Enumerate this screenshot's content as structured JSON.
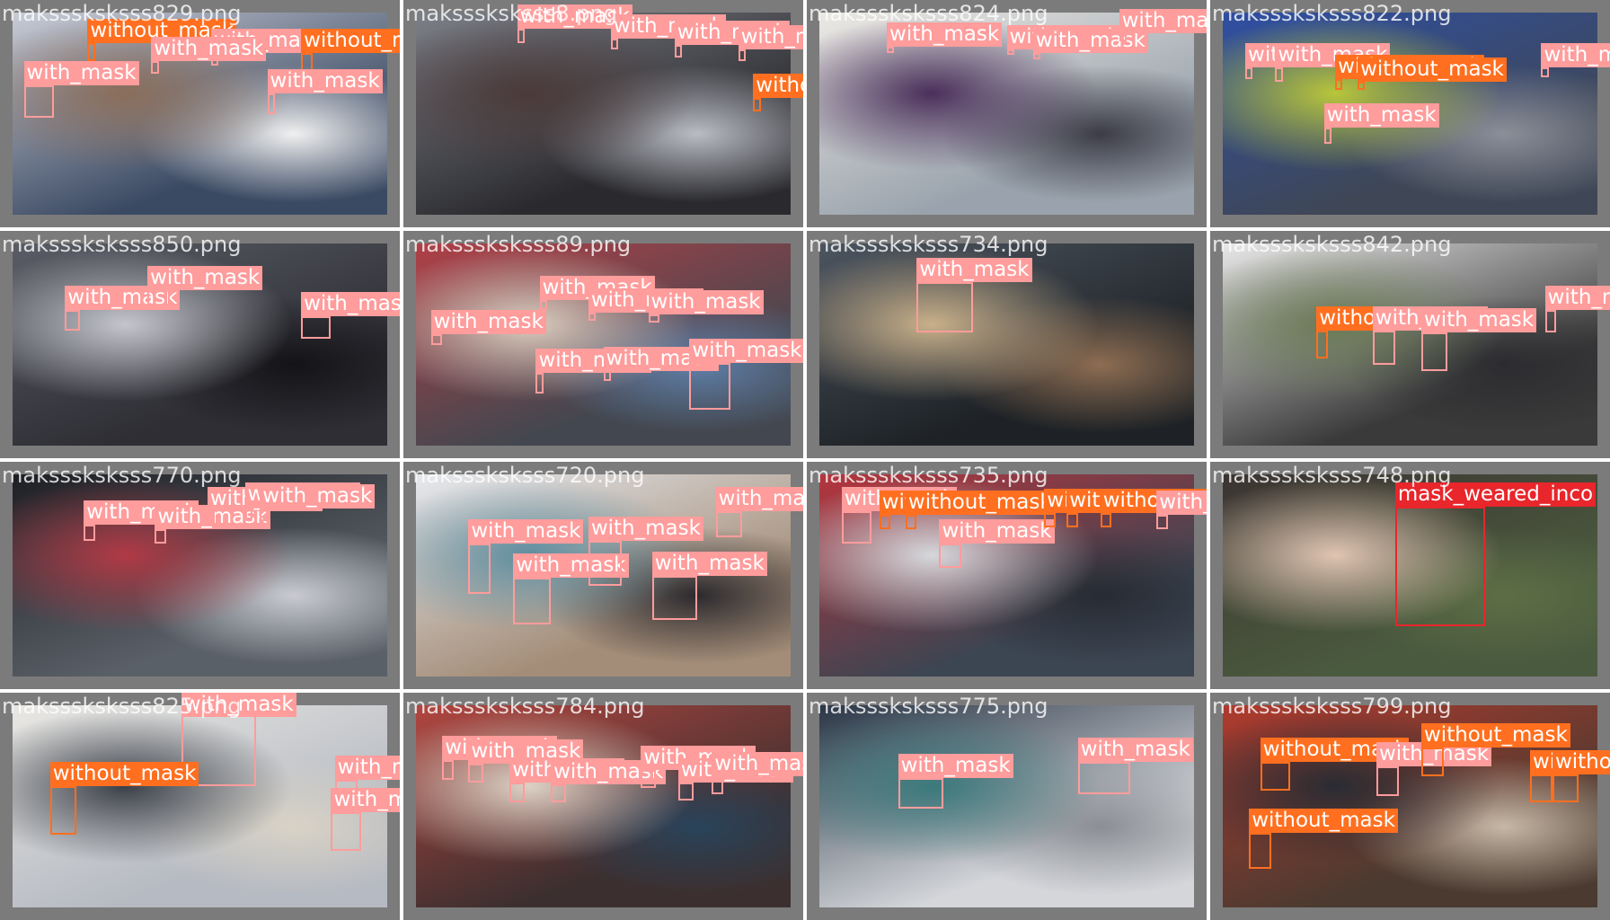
{
  "classes": {
    "with_mask": {
      "label": "with_mask",
      "color": "#ff9c9c"
    },
    "without_mask": {
      "label": "without_mask",
      "color": "#ff6f1f"
    },
    "mask_weared_incorrect": {
      "label": "mask_weared_inco",
      "color": "#e8262b"
    }
  },
  "tiles": [
    {
      "file": "maksssksksss829.png",
      "palette": [
        "#3b4a63",
        "#c9ccd6",
        "#8a6d5a",
        "#f0f0f0"
      ],
      "dets": [
        {
          "c": "with_mask",
          "b": [
            0.03,
            0.36,
            0.11,
            0.52
          ]
        },
        {
          "c": "without_mask",
          "b": [
            0.2,
            0.15,
            0.22,
            0.24
          ]
        },
        {
          "c": "with_mask",
          "b": [
            0.53,
            0.2,
            0.55,
            0.26
          ]
        },
        {
          "c": "without_mask",
          "b": [
            0.77,
            0.2,
            0.8,
            0.33
          ]
        },
        {
          "c": "with_mask",
          "b": [
            0.68,
            0.4,
            0.7,
            0.5
          ]
        },
        {
          "c": "with_mask",
          "b": [
            0.37,
            0.24,
            0.39,
            0.3
          ]
        }
      ]
    },
    {
      "file": "maksssksksss8.png",
      "palette": [
        "#2a2a2e",
        "#7d8088",
        "#4b3a3a",
        "#b9bcc4"
      ],
      "dets": [
        {
          "c": "with_mask",
          "b": [
            0.27,
            0.08,
            0.29,
            0.15
          ]
        },
        {
          "c": "with_mask",
          "b": [
            0.52,
            0.13,
            0.54,
            0.18
          ]
        },
        {
          "c": "with_mask",
          "b": [
            0.69,
            0.16,
            0.71,
            0.22
          ]
        },
        {
          "c": "with_mask",
          "b": [
            0.86,
            0.18,
            0.88,
            0.24
          ]
        },
        {
          "c": "without_mask",
          "b": [
            0.9,
            0.42,
            0.92,
            0.49
          ]
        }
      ]
    },
    {
      "file": "maksssksksss824.png",
      "palette": [
        "#9aa3ad",
        "#ece9e4",
        "#4a2f5a",
        "#3c3c46"
      ],
      "dets": [
        {
          "c": "with_mask",
          "b": [
            0.18,
            0.17,
            0.2,
            0.2
          ]
        },
        {
          "c": "with_mask",
          "b": [
            0.5,
            0.18,
            0.52,
            0.21
          ]
        },
        {
          "c": "with_mask",
          "b": [
            0.57,
            0.2,
            0.59,
            0.23
          ]
        },
        {
          "c": "with_mask",
          "b": [
            0.8,
            0.1,
            0.82,
            0.14
          ]
        }
      ]
    },
    {
      "file": "maksssksksss822.png",
      "palette": [
        "#3f4756",
        "#2e4fa3",
        "#b8c63a",
        "#8c8f98"
      ],
      "dets": [
        {
          "c": "with_mask",
          "b": [
            0.06,
            0.27,
            0.08,
            0.33
          ]
        },
        {
          "c": "with_mask",
          "b": [
            0.14,
            0.27,
            0.16,
            0.34
          ]
        },
        {
          "c": "without_mask",
          "b": [
            0.3,
            0.33,
            0.32,
            0.38
          ]
        },
        {
          "c": "without_mask",
          "b": [
            0.36,
            0.34,
            0.38,
            0.38
          ]
        },
        {
          "c": "with_mask",
          "b": [
            0.27,
            0.57,
            0.29,
            0.65
          ]
        },
        {
          "c": "with_mask",
          "b": [
            0.85,
            0.27,
            0.87,
            0.32
          ]
        }
      ]
    },
    {
      "file": "maksssksksss850.png",
      "palette": [
        "#2e2e34",
        "#5a5d66",
        "#c4c6cc",
        "#141418"
      ],
      "dets": [
        {
          "c": "with_mask",
          "b": [
            0.14,
            0.33,
            0.18,
            0.43
          ]
        },
        {
          "c": "with_mask",
          "b": [
            0.36,
            0.23,
            0.42,
            0.32
          ]
        },
        {
          "c": "with_mask",
          "b": [
            0.77,
            0.36,
            0.85,
            0.47
          ]
        }
      ]
    },
    {
      "file": "maksssksksss89.png",
      "palette": [
        "#43474f",
        "#b04047",
        "#d8cfc1",
        "#5f7fa8"
      ],
      "dets": [
        {
          "c": "with_mask",
          "b": [
            0.04,
            0.45,
            0.07,
            0.5
          ]
        },
        {
          "c": "with_mask",
          "b": [
            0.33,
            0.28,
            0.35,
            0.33
          ]
        },
        {
          "c": "with_mask",
          "b": [
            0.46,
            0.34,
            0.48,
            0.38
          ]
        },
        {
          "c": "with_mask",
          "b": [
            0.62,
            0.35,
            0.65,
            0.39
          ]
        },
        {
          "c": "with_mask",
          "b": [
            0.32,
            0.64,
            0.34,
            0.74
          ]
        },
        {
          "c": "with_mask",
          "b": [
            0.5,
            0.63,
            0.52,
            0.68
          ]
        },
        {
          "c": "with_mask",
          "b": [
            0.73,
            0.59,
            0.84,
            0.82
          ]
        }
      ]
    },
    {
      "file": "maksssksksss734.png",
      "palette": [
        "#1e2226",
        "#4c5560",
        "#c9b08a",
        "#8d6d52"
      ],
      "dets": [
        {
          "c": "with_mask",
          "b": [
            0.26,
            0.19,
            0.41,
            0.44
          ]
        }
      ]
    },
    {
      "file": "maksssksksss842.png",
      "palette": [
        "#3a3a3a",
        "#e8e8e8",
        "#6b7a55",
        "#2c2c30"
      ],
      "dets": [
        {
          "c": "without_mask",
          "b": [
            0.25,
            0.43,
            0.28,
            0.57
          ]
        },
        {
          "c": "with_mask",
          "b": [
            0.4,
            0.43,
            0.46,
            0.6
          ]
        },
        {
          "c": "with_mask",
          "b": [
            0.53,
            0.44,
            0.6,
            0.63
          ]
        },
        {
          "c": "with_mask",
          "b": [
            0.86,
            0.33,
            0.89,
            0.44
          ]
        }
      ]
    },
    {
      "file": "maksssksksss770.png",
      "palette": [
        "#5a6068",
        "#1d1f24",
        "#b03a45",
        "#c9cbd1"
      ],
      "dets": [
        {
          "c": "with_mask",
          "b": [
            0.19,
            0.25,
            0.22,
            0.33
          ]
        },
        {
          "c": "with_mask",
          "b": [
            0.38,
            0.27,
            0.41,
            0.34
          ]
        },
        {
          "c": "with_mask",
          "b": [
            0.52,
            0.18,
            0.54,
            0.25
          ]
        },
        {
          "c": "with_mask",
          "b": [
            0.62,
            0.16,
            0.64,
            0.22
          ]
        },
        {
          "c": "with_mask",
          "b": [
            0.66,
            0.17,
            0.68,
            0.23
          ]
        }
      ]
    },
    {
      "file": "maksssksksss720.png",
      "palette": [
        "#a48d78",
        "#e6e9ee",
        "#5f8ea0",
        "#2c2a2e"
      ],
      "dets": [
        {
          "c": "with_mask",
          "b": [
            0.14,
            0.34,
            0.2,
            0.59
          ]
        },
        {
          "c": "with_mask",
          "b": [
            0.26,
            0.51,
            0.36,
            0.74
          ]
        },
        {
          "c": "with_mask",
          "b": [
            0.46,
            0.33,
            0.55,
            0.55
          ]
        },
        {
          "c": "with_mask",
          "b": [
            0.63,
            0.5,
            0.75,
            0.72
          ]
        },
        {
          "c": "with_mask",
          "b": [
            0.8,
            0.18,
            0.87,
            0.31
          ]
        }
      ]
    },
    {
      "file": "maksssksksss735.png",
      "palette": [
        "#3c4552",
        "#b5353d",
        "#d6d8dc",
        "#272b33"
      ],
      "dets": [
        {
          "c": "with_mask",
          "b": [
            0.06,
            0.18,
            0.14,
            0.34
          ]
        },
        {
          "c": "without_mask",
          "b": [
            0.16,
            0.2,
            0.19,
            0.27
          ]
        },
        {
          "c": "without_mask",
          "b": [
            0.23,
            0.2,
            0.26,
            0.27
          ]
        },
        {
          "c": "with_mask",
          "b": [
            0.32,
            0.34,
            0.38,
            0.46
          ]
        },
        {
          "c": "without_mask",
          "b": [
            0.6,
            0.19,
            0.63,
            0.26
          ]
        },
        {
          "c": "without_mask",
          "b": [
            0.66,
            0.19,
            0.69,
            0.26
          ]
        },
        {
          "c": "without_mask",
          "b": [
            0.75,
            0.19,
            0.78,
            0.26
          ]
        },
        {
          "c": "with_mask",
          "b": [
            0.9,
            0.2,
            0.93,
            0.27
          ]
        }
      ]
    },
    {
      "file": "maksssksksss748.png",
      "palette": [
        "#4a5a3e",
        "#3c3432",
        "#e0c4b2",
        "#5d6e46"
      ],
      "dets": [
        {
          "c": "mask_weared_incorrect",
          "b": [
            0.46,
            0.16,
            0.7,
            0.75
          ]
        }
      ]
    },
    {
      "file": "maksssksksss825.png",
      "palette": [
        "#b6bac2",
        "#e8e7e3",
        "#3b3f47",
        "#d9d3c6"
      ],
      "dets": [
        {
          "c": "with_mask",
          "b": [
            0.45,
            0.04,
            0.65,
            0.4
          ]
        },
        {
          "c": "without_mask",
          "b": [
            0.1,
            0.4,
            0.17,
            0.64
          ]
        },
        {
          "c": "with_mask",
          "b": [
            0.86,
            0.37,
            0.92,
            0.53
          ]
        },
        {
          "c": "with_mask",
          "b": [
            0.85,
            0.53,
            0.93,
            0.72
          ]
        }
      ]
    },
    {
      "file": "maksssksksss784.png",
      "palette": [
        "#3c2f2f",
        "#b24640",
        "#dcd2c6",
        "#29435a"
      ],
      "dets": [
        {
          "c": "with_mask",
          "b": [
            0.07,
            0.27,
            0.1,
            0.37
          ]
        },
        {
          "c": "with_mask",
          "b": [
            0.14,
            0.29,
            0.18,
            0.38
          ]
        },
        {
          "c": "with_mask",
          "b": [
            0.25,
            0.38,
            0.29,
            0.48
          ]
        },
        {
          "c": "with_mask",
          "b": [
            0.36,
            0.39,
            0.4,
            0.48
          ]
        },
        {
          "c": "with_mask",
          "b": [
            0.6,
            0.32,
            0.64,
            0.41
          ]
        },
        {
          "c": "with_mask",
          "b": [
            0.7,
            0.38,
            0.74,
            0.47
          ]
        },
        {
          "c": "with_mask",
          "b": [
            0.79,
            0.35,
            0.82,
            0.44
          ]
        }
      ]
    },
    {
      "file": "maksssksksss775.png",
      "palette": [
        "#d4d6da",
        "#2a3646",
        "#3c7a7c",
        "#8b8e94"
      ],
      "dets": [
        {
          "c": "with_mask",
          "b": [
            0.21,
            0.36,
            0.33,
            0.51
          ]
        },
        {
          "c": "with_mask",
          "b": [
            0.69,
            0.28,
            0.83,
            0.44
          ]
        }
      ]
    },
    {
      "file": "maksssksksss799.png",
      "palette": [
        "#4a3a30",
        "#b03a2e",
        "#2a2c33",
        "#c7b8a6"
      ],
      "dets": [
        {
          "c": "without_mask",
          "b": [
            0.1,
            0.28,
            0.18,
            0.42
          ]
        },
        {
          "c": "with_mask",
          "b": [
            0.41,
            0.3,
            0.47,
            0.45
          ]
        },
        {
          "c": "without_mask",
          "b": [
            0.53,
            0.21,
            0.59,
            0.35
          ]
        },
        {
          "c": "without_mask",
          "b": [
            0.82,
            0.34,
            0.88,
            0.48
          ]
        },
        {
          "c": "without_mask",
          "b": [
            0.88,
            0.34,
            0.95,
            0.48
          ]
        },
        {
          "c": "without_mask",
          "b": [
            0.07,
            0.63,
            0.13,
            0.81
          ]
        }
      ]
    }
  ]
}
